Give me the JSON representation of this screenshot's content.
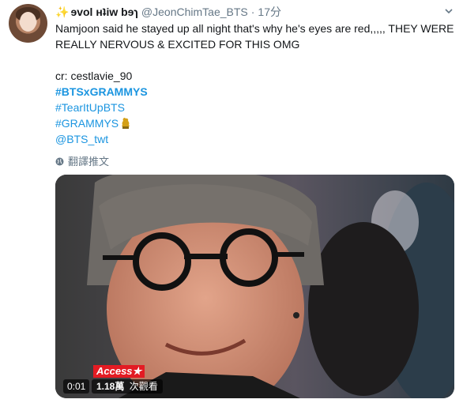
{
  "tweet": {
    "display_name": "ɘvol ʜʇiw bɘɿ",
    "handle": "@JeonChimTae_BTS",
    "separator": "·",
    "time": "17分",
    "text_lines": [
      "Namjoon said he stayed up all night that's why he's eyes are red,,,,, THEY WERE",
      "REALLY NERVOUS & EXCITED FOR THIS OMG"
    ],
    "credit": "cr: cestlavie_90",
    "hashtags": [
      "#BTSxGRAMMYS",
      "#TearItUpBTS",
      "#GRAMMYS"
    ],
    "mention": "@BTS_twt",
    "translate_label": "翻譯推文"
  },
  "video": {
    "overlay_brand": "Access★",
    "timecode": "0:01",
    "view_count": "1.18萬",
    "view_label": "次觀看"
  },
  "icons": {
    "sparkle": "sparkle-icon",
    "trophy": "trophy-icon",
    "globe": "globe-icon",
    "chevron": "chevron-down-icon"
  },
  "colors": {
    "link": "#1b95e0",
    "muted": "#657786",
    "text": "#14171a",
    "access_red": "#e31b23"
  }
}
